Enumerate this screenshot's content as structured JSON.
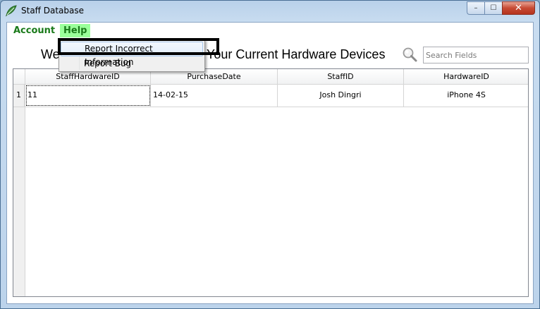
{
  "window": {
    "title": "Staff Database",
    "app_icon": "leaf-icon",
    "minimize_glyph": "–",
    "maximize_glyph": "☐",
    "close_glyph": "✕"
  },
  "menu": {
    "account_label": "Account",
    "help_label": "Help",
    "help_items": [
      "Report Incorrect Information",
      "Report Bug"
    ]
  },
  "heading": {
    "left": "We",
    "right": "Your Current Hardware Devices"
  },
  "search": {
    "placeholder": "Search Fields",
    "value": ""
  },
  "table": {
    "columns": [
      "StaffHardwareID",
      "PurchaseDate",
      "StaffID",
      "HardwareID"
    ],
    "rows": [
      {
        "num": "1",
        "cells": [
          "11",
          "14-02-15",
          "Josh Dingri",
          "iPhone 4S"
        ]
      }
    ]
  },
  "colors": {
    "menu_text": "#1a7a1a",
    "menu_help_bg": "#9aff9a",
    "close_button": "#c74a34"
  }
}
